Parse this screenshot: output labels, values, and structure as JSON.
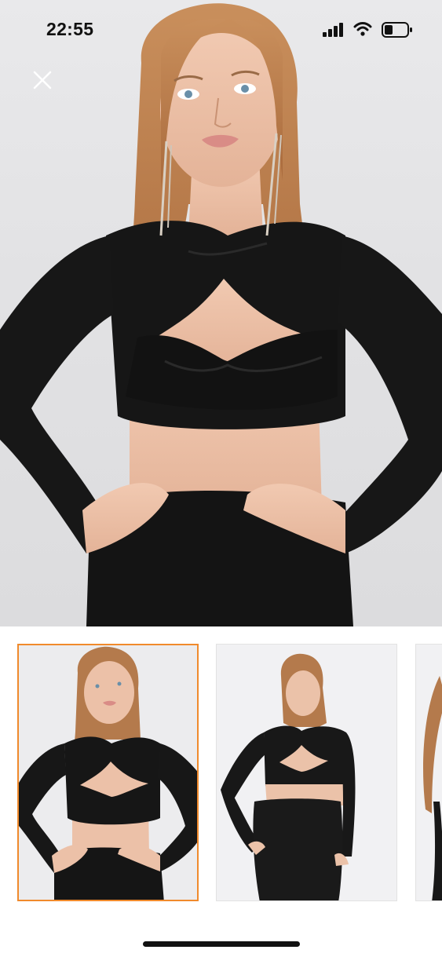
{
  "status_bar": {
    "time": "22:55",
    "signal_icon": "cellular-signal-icon",
    "wifi_icon": "wifi-icon",
    "battery_icon": "battery-icon"
  },
  "viewer": {
    "close_icon": "close-icon",
    "main_image": "product-photo-model-black-crop-top",
    "selected_thumbnail_index": 0
  },
  "thumbnails": [
    {
      "name": "thumbnail-front-closeup",
      "selected": true
    },
    {
      "name": "thumbnail-full-body-angle",
      "selected": false
    },
    {
      "name": "thumbnail-side-partial",
      "selected": false
    }
  ],
  "colors": {
    "selected_border": "#f08a2c",
    "garment": "#111111",
    "background": "#e6e6e8"
  }
}
